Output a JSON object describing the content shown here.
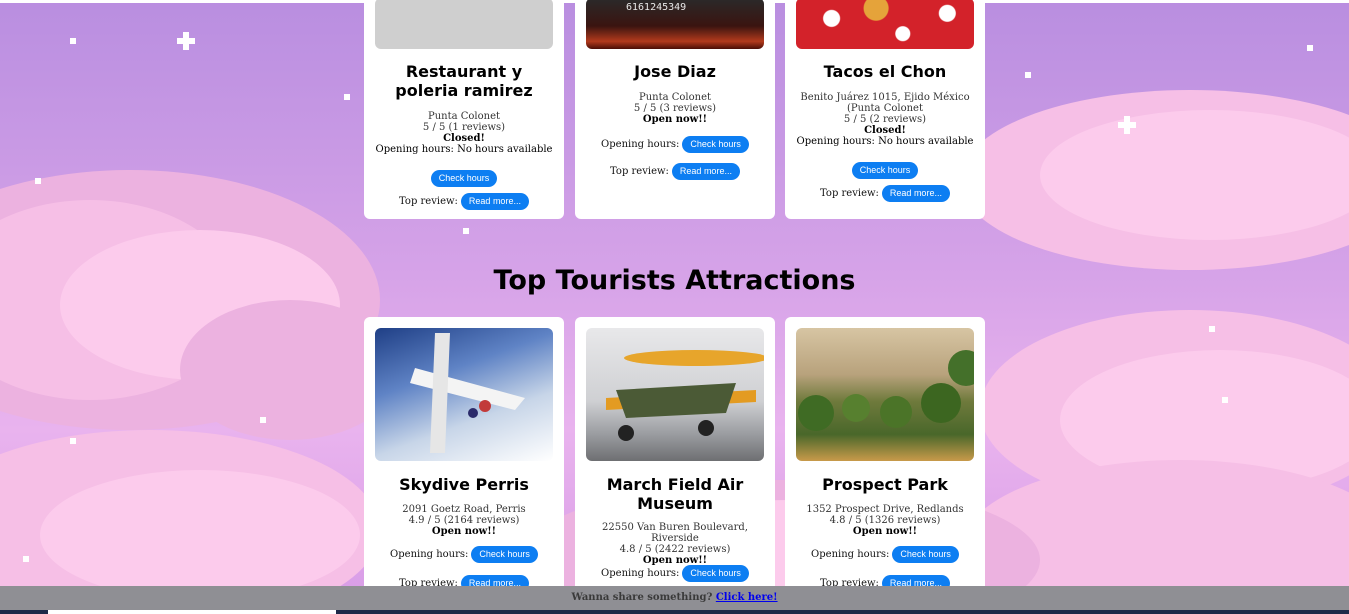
{
  "restaurants": [
    {
      "name": "Restaurant y poleria ramirez",
      "location": "Punta Colonet",
      "rating": "5 / 5 (1 reviews)",
      "status": "Closed!",
      "hours_text": "Opening hours: No hours available",
      "check_label": "Check hours",
      "top_review_label": "Top review:",
      "read_more_label": "Read more..."
    },
    {
      "name": "Jose Diaz",
      "location": "Punta Colonet",
      "rating": "5 / 5 (3 reviews)",
      "status": "Open now!!",
      "hours_label": "Opening hours:",
      "check_label": "Check hours",
      "top_review_label": "Top review:",
      "read_more_label": "Read more...",
      "image_text": "6161245349"
    },
    {
      "name": "Tacos el Chon",
      "location": "Benito Juárez 1015, Ejido México (Punta Colonet",
      "rating": "5 / 5 (2 reviews)",
      "status": "Closed!",
      "hours_text": "Opening hours: No hours available",
      "check_label": "Check hours",
      "top_review_label": "Top review:",
      "read_more_label": "Read more..."
    }
  ],
  "section_title": "Top Tourists Attractions",
  "attractions": [
    {
      "name": "Skydive Perris",
      "location": "2091 Goetz Road, Perris",
      "rating": "4.9 / 5 (2164 reviews)",
      "status": "Open now!!",
      "hours_label": "Opening hours:",
      "check_label": "Check hours",
      "top_review_label": "Top review:",
      "read_more_label": "Read more..."
    },
    {
      "name": "March Field Air Museum",
      "location": "22550 Van Buren Boulevard, Riverside",
      "rating": "4.8 / 5 (2422 reviews)",
      "status": "Open now!!",
      "hours_label": "Opening hours:",
      "check_label": "Check hours"
    },
    {
      "name": "Prospect Park",
      "location": "1352 Prospect Drive, Redlands",
      "rating": "4.8 / 5 (1326 reviews)",
      "status": "Open now!!",
      "hours_label": "Opening hours:",
      "check_label": "Check hours",
      "top_review_label": "Top review:",
      "read_more_label": "Read more..."
    }
  ],
  "footer": {
    "prompt": "Wanna share something?",
    "link": "Click here!"
  }
}
